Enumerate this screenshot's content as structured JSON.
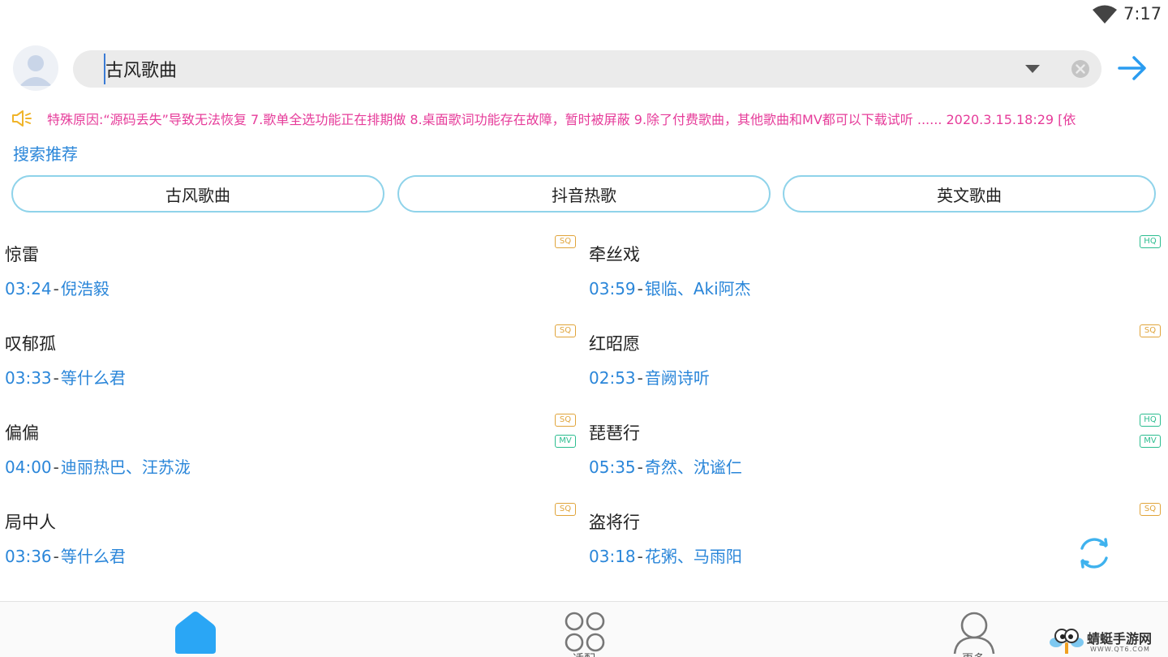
{
  "status_bar": {
    "time": "7:17"
  },
  "search": {
    "value": "古风歌曲"
  },
  "notice": {
    "text": "特殊原因:“源码丢失”导致无法恢复 7.歌单全选功能正在排期做 8.桌面歌词功能存在故障，暂时被屏蔽 9.除了付费歌曲，其他歌曲和MV都可以下载试听 ...... 2020.3.15.18:29  [依"
  },
  "recommend": {
    "title": "搜索推荐",
    "chips": [
      "古风歌曲",
      "抖音热歌",
      "英文歌曲"
    ]
  },
  "songs": [
    {
      "title": "惊雷",
      "duration": "03:24",
      "artist": "倪浩毅",
      "badges": [
        "SQ"
      ]
    },
    {
      "title": "牵丝戏",
      "duration": "03:59",
      "artist": "银临、Aki阿杰",
      "badges": [
        "HQ"
      ]
    },
    {
      "title": "叹郁孤",
      "duration": "03:33",
      "artist": "等什么君",
      "badges": [
        "SQ"
      ]
    },
    {
      "title": "红昭愿",
      "duration": "02:53",
      "artist": "音阙诗听",
      "badges": [
        "SQ"
      ]
    },
    {
      "title": "偏偏",
      "duration": "04:00",
      "artist": "迪丽热巴、汪苏泷",
      "badges": [
        "SQ",
        "MV"
      ]
    },
    {
      "title": "琵琶行",
      "duration": "05:35",
      "artist": "奇然、沈谧仁",
      "badges": [
        "HQ",
        "MV"
      ]
    },
    {
      "title": "局中人",
      "duration": "03:36",
      "artist": "等什么君",
      "badges": [
        "SQ"
      ]
    },
    {
      "title": "盗将行",
      "duration": "03:18",
      "artist": "花粥、马雨阳",
      "badges": [
        "SQ"
      ]
    }
  ],
  "bottom_nav": [
    {
      "label": "",
      "icon": "home-icon",
      "active": true
    },
    {
      "label": "适配",
      "icon": "apps-grid-icon",
      "active": false
    },
    {
      "label": "更多",
      "icon": "user-icon",
      "active": false
    }
  ],
  "watermark": {
    "name": "蜻蜓手游网",
    "url": "WWW.QT6.COM"
  },
  "colors": {
    "accent": "#2a86d9",
    "notice": "#e63c9a",
    "chip_border": "#8fd3ea",
    "sq": "#e0a43a",
    "hq": "#2bbd8f",
    "home_active": "#2aa6f5"
  }
}
